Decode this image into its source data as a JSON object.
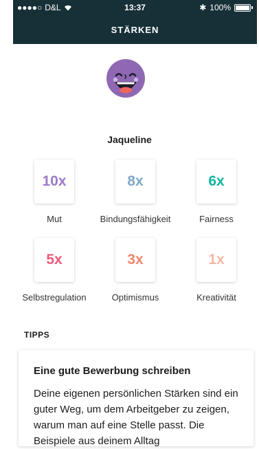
{
  "status": {
    "carrier": "D&L",
    "time": "13:37",
    "battery": "100%"
  },
  "header": {
    "title": "STÄRKEN"
  },
  "profile": {
    "name": "Jaqueline"
  },
  "strengths": [
    {
      "value": "10x",
      "label": "Mut",
      "color": "#9a7bc7"
    },
    {
      "value": "8x",
      "label": "Bindungsfähigkeit",
      "color": "#7fa7c9"
    },
    {
      "value": "6x",
      "label": "Fairness",
      "color": "#11b4a3"
    },
    {
      "value": "5x",
      "label": "Selbstregulation",
      "color": "#ef5a7e"
    },
    {
      "value": "3x",
      "label": "Optimismus",
      "color": "#f1876b"
    },
    {
      "value": "1x",
      "label": "Kreativität",
      "color": "#f6b7a6"
    }
  ],
  "tips": {
    "section_title": "TIPPS",
    "card_title": "Eine gute Bewerbung schreiben",
    "card_text": "Deine eigenen persönlichen Stärken sind ein guter Weg, um dem Arbeitgeber zu zeigen, warum man auf eine Stelle passt. Die Beispiele aus deinem Alltag"
  }
}
